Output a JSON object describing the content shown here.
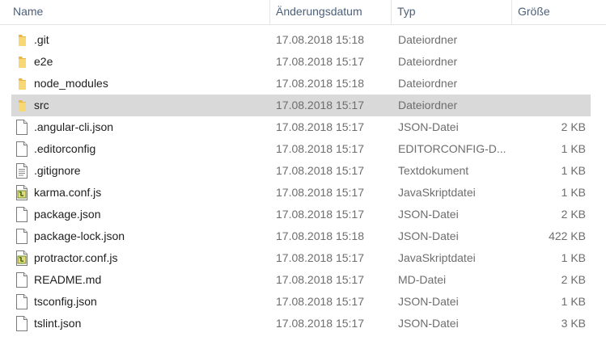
{
  "columns": {
    "name": "Name",
    "date": "Änderungsdatum",
    "type": "Typ",
    "size": "Größe"
  },
  "files": [
    {
      "name": ".git",
      "date": "17.08.2018 15:18",
      "type": "Dateiordner",
      "size": "",
      "icon": "folder-icon",
      "selected": false
    },
    {
      "name": "e2e",
      "date": "17.08.2018 15:17",
      "type": "Dateiordner",
      "size": "",
      "icon": "folder-icon",
      "selected": false
    },
    {
      "name": "node_modules",
      "date": "17.08.2018 15:18",
      "type": "Dateiordner",
      "size": "",
      "icon": "folder-icon",
      "selected": false
    },
    {
      "name": "src",
      "date": "17.08.2018 15:17",
      "type": "Dateiordner",
      "size": "",
      "icon": "folder-icon",
      "selected": true
    },
    {
      "name": ".angular-cli.json",
      "date": "17.08.2018 15:17",
      "type": "JSON-Datei",
      "size": "2 KB",
      "icon": "file-icon",
      "selected": false
    },
    {
      "name": ".editorconfig",
      "date": "17.08.2018 15:17",
      "type": "EDITORCONFIG-D...",
      "size": "1 KB",
      "icon": "file-icon",
      "selected": false
    },
    {
      "name": ".gitignore",
      "date": "17.08.2018 15:17",
      "type": "Textdokument",
      "size": "1 KB",
      "icon": "text-file-icon",
      "selected": false
    },
    {
      "name": "karma.conf.js",
      "date": "17.08.2018 15:17",
      "type": "JavaSkriptdatei",
      "size": "1 KB",
      "icon": "script-file-icon",
      "selected": false
    },
    {
      "name": "package.json",
      "date": "17.08.2018 15:17",
      "type": "JSON-Datei",
      "size": "2 KB",
      "icon": "file-icon",
      "selected": false
    },
    {
      "name": "package-lock.json",
      "date": "17.08.2018 15:18",
      "type": "JSON-Datei",
      "size": "422 KB",
      "icon": "file-icon",
      "selected": false
    },
    {
      "name": "protractor.conf.js",
      "date": "17.08.2018 15:17",
      "type": "JavaSkriptdatei",
      "size": "1 KB",
      "icon": "script-file-icon",
      "selected": false
    },
    {
      "name": "README.md",
      "date": "17.08.2018 15:17",
      "type": "MD-Datei",
      "size": "2 KB",
      "icon": "file-icon",
      "selected": false
    },
    {
      "name": "tsconfig.json",
      "date": "17.08.2018 15:17",
      "type": "JSON-Datei",
      "size": "1 KB",
      "icon": "file-icon",
      "selected": false
    },
    {
      "name": "tslint.json",
      "date": "17.08.2018 15:17",
      "type": "JSON-Datei",
      "size": "3 KB",
      "icon": "file-icon",
      "selected": false
    }
  ],
  "colors": {
    "selection": "#d9d9d9",
    "header_text": "#4c607a",
    "folder": "#f8d775"
  }
}
